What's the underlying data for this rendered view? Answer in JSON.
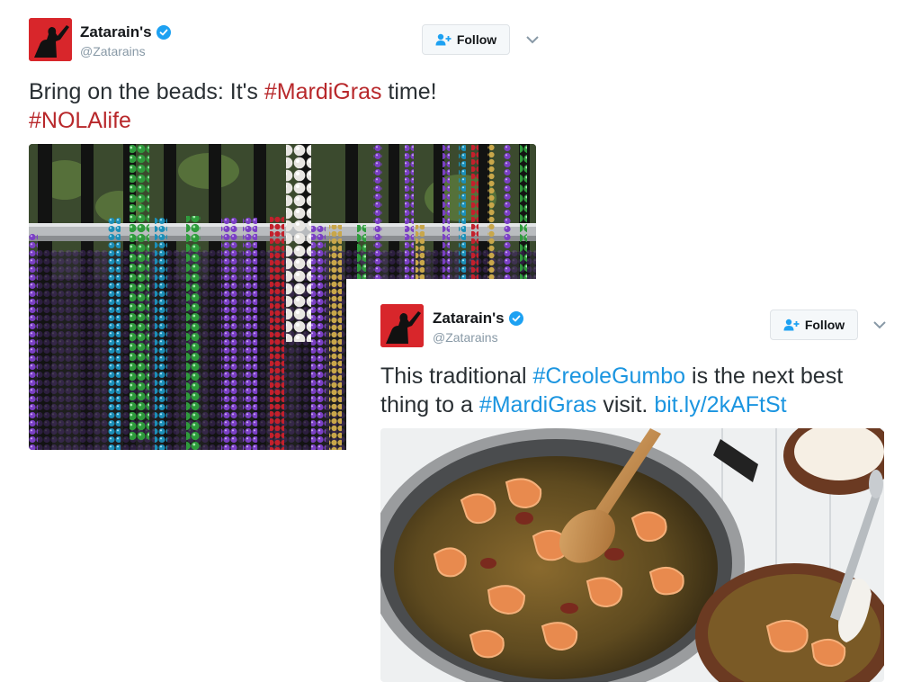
{
  "tweets": [
    {
      "display_name": "Zatarain's",
      "handle": "@Zatarains",
      "verified": true,
      "follow_label": "Follow",
      "text": {
        "line1_prefix": "Bring on the beads: It's ",
        "line1_hashtag": "#MardiGras",
        "line1_suffix": " time!",
        "line2_hashtag": "#NOLAlife"
      },
      "media_icon": "mardi-gras-beads-on-fence-photo"
    },
    {
      "display_name": "Zatarain's",
      "handle": "@Zatarains",
      "verified": true,
      "follow_label": "Follow",
      "text": {
        "line1_prefix": "This traditional ",
        "line1_hashtag": "#CreoleGumbo",
        "line1_suffix": " is the next best",
        "line2_prefix": "thing to a ",
        "line2_hashtag": "#MardiGras",
        "line2_middle": " visit. ",
        "line2_link": "bit.ly/2kAFtSt"
      },
      "media_icon": "shrimp-gumbo-pot-photo"
    }
  ],
  "colors": {
    "brand_red": "#d8262b",
    "hashtag_red": "#b8282b",
    "link_blue": "#1b95e0",
    "verified_blue": "#1da1f2"
  }
}
